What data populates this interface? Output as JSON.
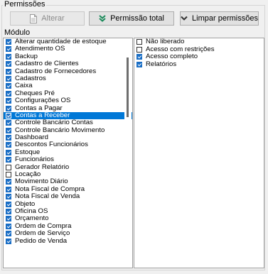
{
  "group": {
    "title": "Permissões"
  },
  "toolbar": {
    "alterar_label": "Alterar",
    "permissao_total_label": "Permissão total",
    "limpar_label": "Limpar permissões"
  },
  "icons": {
    "document": "document-icon",
    "double_chevron_down": "double-chevron-down-icon",
    "chevron_down": "chevron-down-icon"
  },
  "colors": {
    "check": "#1a6ec5",
    "selection": "#0078d7",
    "chevron_green": "#1a8a5a"
  },
  "modules": {
    "header": "Módulo",
    "items": [
      {
        "label": "Alterar quantidade de estoque",
        "checked": true
      },
      {
        "label": "Atendimento OS",
        "checked": true
      },
      {
        "label": "Backup",
        "checked": true
      },
      {
        "label": "Cadastro de Clientes",
        "checked": true
      },
      {
        "label": "Cadastro de Fornecedores",
        "checked": true
      },
      {
        "label": "Cadastros",
        "checked": true
      },
      {
        "label": "Caixa",
        "checked": true
      },
      {
        "label": "Cheques Pré",
        "checked": true
      },
      {
        "label": "Configurações OS",
        "checked": true
      },
      {
        "label": "Contas a Pagar",
        "checked": true
      },
      {
        "label": "Contas a Receber",
        "checked": true,
        "selected": true
      },
      {
        "label": "Controle Bancário Contas",
        "checked": true
      },
      {
        "label": "Controle Bancário Movimento",
        "checked": true
      },
      {
        "label": "Dashboard",
        "checked": true
      },
      {
        "label": "Descontos Funcionários",
        "checked": true
      },
      {
        "label": "Estoque",
        "checked": true
      },
      {
        "label": "Funcionários",
        "checked": true
      },
      {
        "label": "Gerador Relatório",
        "checked": false
      },
      {
        "label": "Locação",
        "checked": false
      },
      {
        "label": "Movimento Diário",
        "checked": true
      },
      {
        "label": "Nota Fiscal de Compra",
        "checked": true
      },
      {
        "label": "Nota Fiscal de Venda",
        "checked": true
      },
      {
        "label": "Objeto",
        "checked": true
      },
      {
        "label": "Oficina OS",
        "checked": true
      },
      {
        "label": "Orçamento",
        "checked": true
      },
      {
        "label": "Ordem de Compra",
        "checked": true
      },
      {
        "label": "Ordem de Serviço",
        "checked": true
      },
      {
        "label": "Pedido de Venda",
        "checked": true
      }
    ]
  },
  "access": {
    "items": [
      {
        "label": "Não liberado",
        "checked": false
      },
      {
        "label": "Acesso com restrições",
        "checked": false
      },
      {
        "label": "Acesso completo",
        "checked": true
      },
      {
        "label": "Relatórios",
        "checked": true
      }
    ]
  }
}
